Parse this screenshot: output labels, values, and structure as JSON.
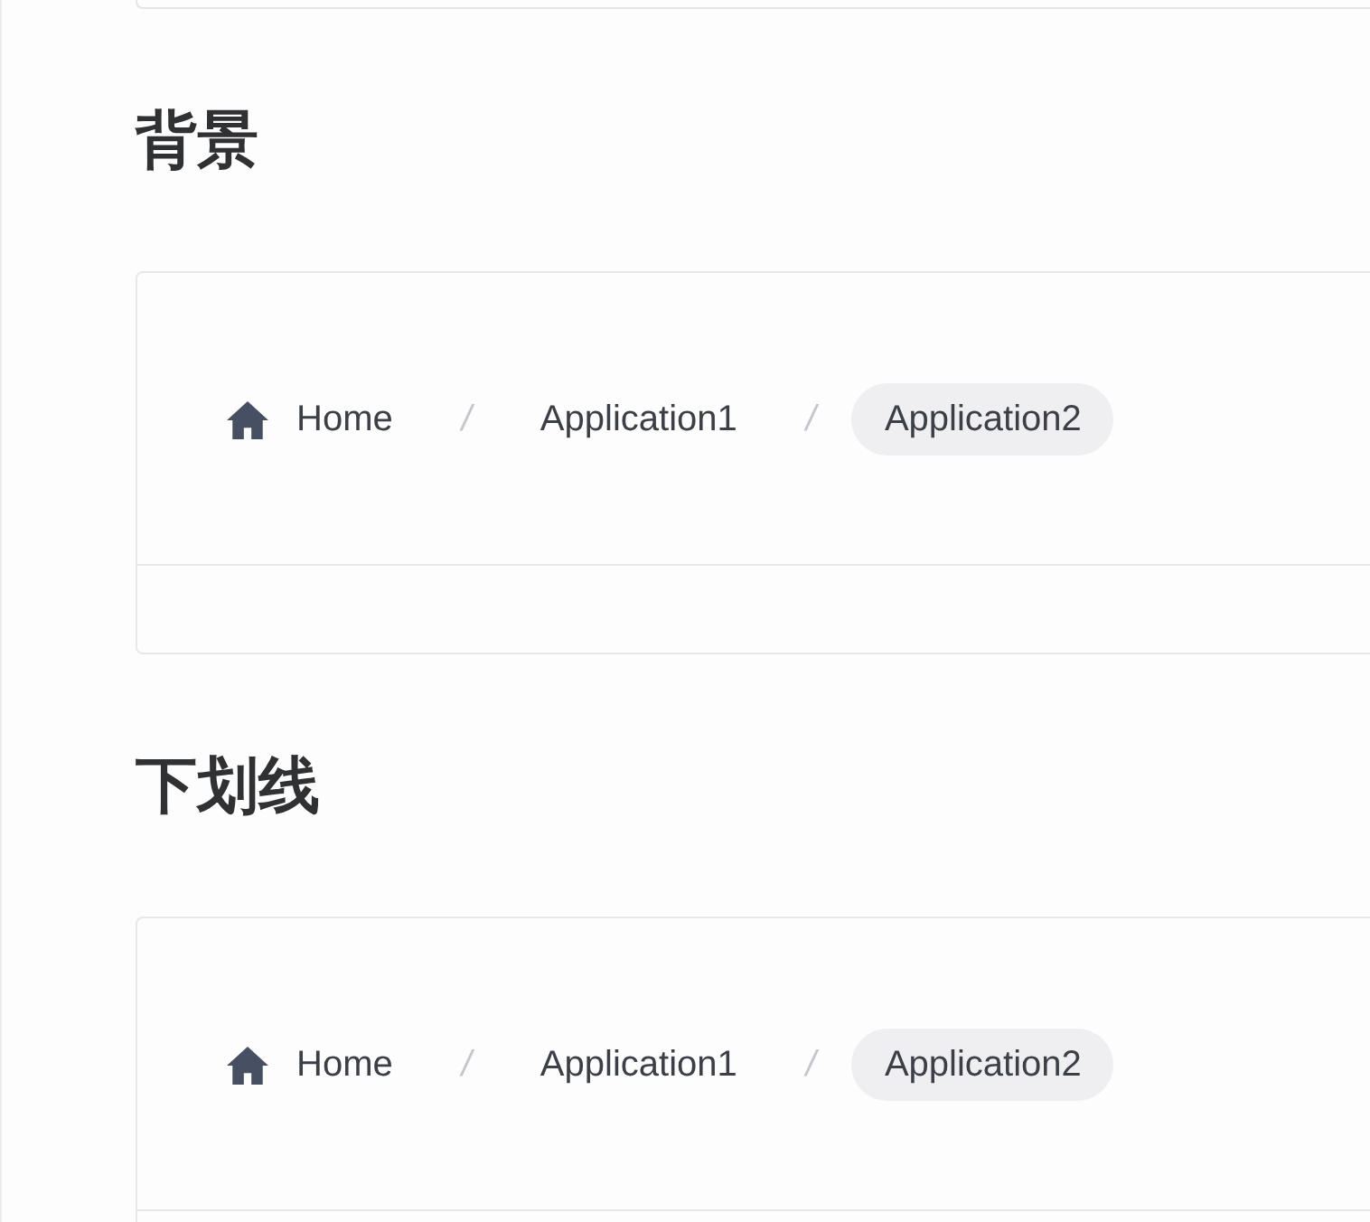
{
  "sections": [
    {
      "heading": "背景",
      "breadcrumb": [
        {
          "label": "Home",
          "kind": "home",
          "selected": false
        },
        {
          "label": "/",
          "kind": "separator"
        },
        {
          "label": "Application1",
          "kind": "link",
          "selected": false
        },
        {
          "label": "/",
          "kind": "separator"
        },
        {
          "label": "Application2",
          "kind": "link",
          "selected": true
        }
      ]
    },
    {
      "heading": "下划线",
      "breadcrumb": [
        {
          "label": "Home",
          "kind": "home",
          "selected": false
        },
        {
          "label": "/",
          "kind": "separator"
        },
        {
          "label": "Application1",
          "kind": "link",
          "selected": false
        },
        {
          "label": "/",
          "kind": "separator"
        },
        {
          "label": "Application2",
          "kind": "link",
          "selected": true
        }
      ]
    }
  ]
}
